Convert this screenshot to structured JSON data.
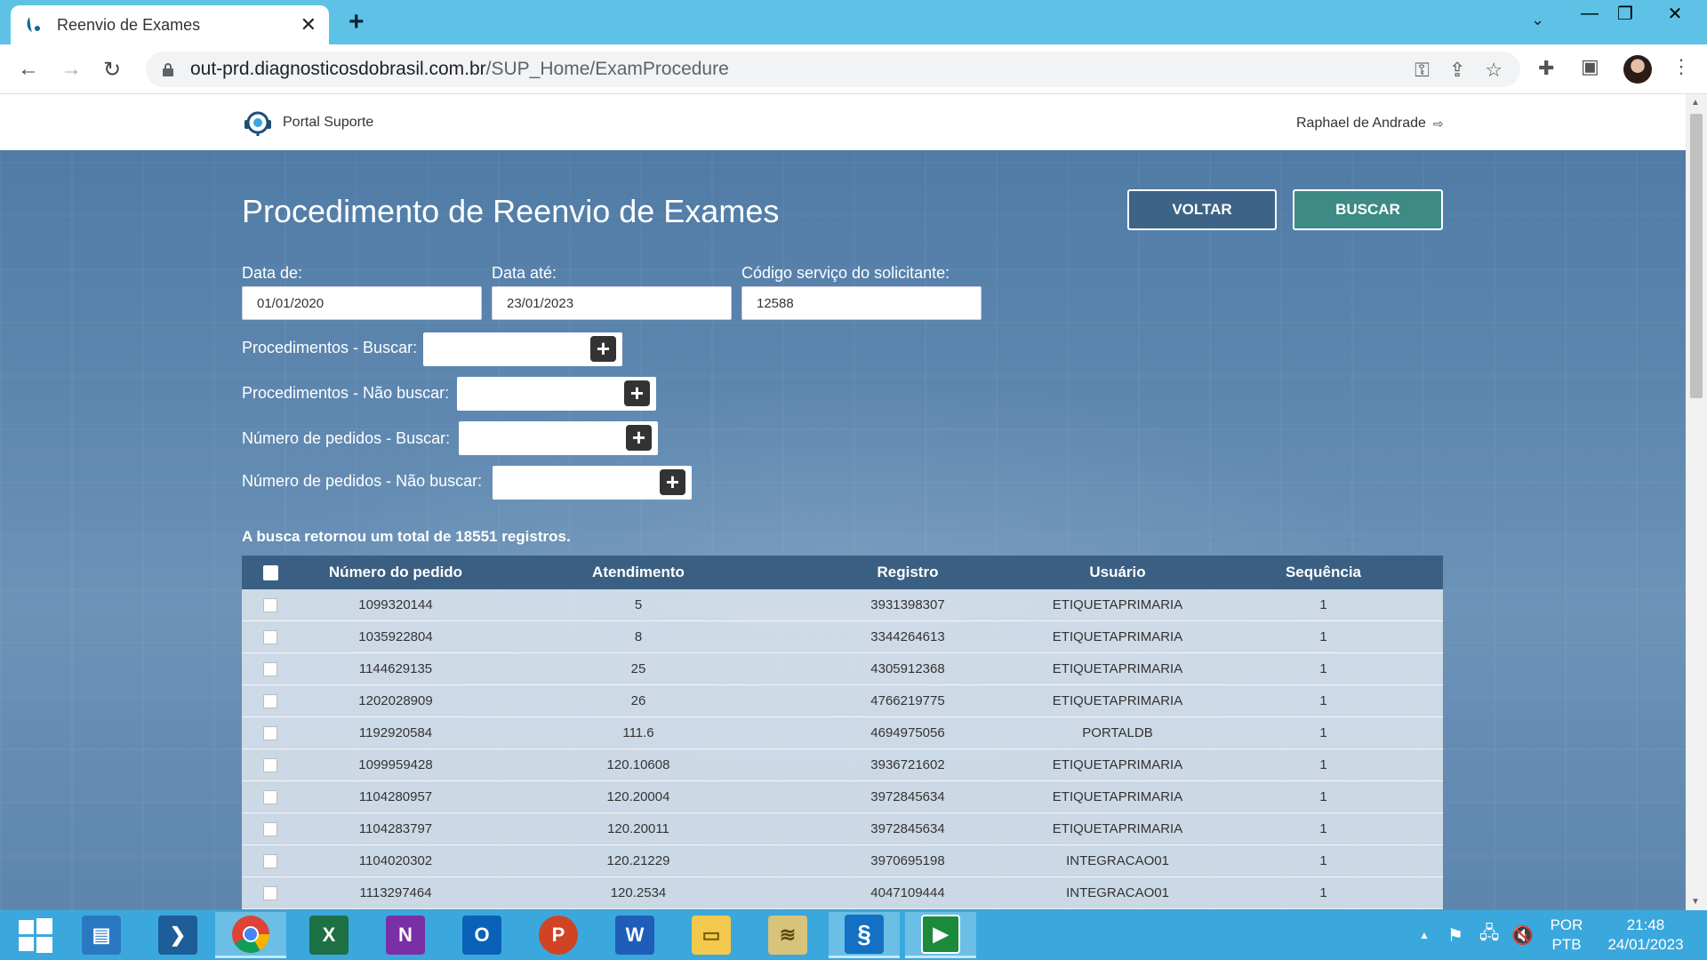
{
  "browser": {
    "tab_title": "Reenvio de Exames",
    "url_host": "out-prd.diagnosticosdobrasil.com.br",
    "url_path": "/SUP_Home/ExamProcedure"
  },
  "header": {
    "brand": "Portal Suporte",
    "user_name": "Raphael de Andrade"
  },
  "page": {
    "title": "Procedimento de Reenvio de Exames",
    "voltar_label": "VOLTAR",
    "buscar_label": "BUSCAR"
  },
  "form": {
    "data_de_label": "Data de:",
    "data_de_value": "01/01/2020",
    "data_ate_label": "Data até:",
    "data_ate_value": "23/01/2023",
    "codigo_label": "Código serviço do solicitante:",
    "codigo_value": "12588",
    "proc_buscar_label": "Procedimentos - Buscar:",
    "proc_nao_buscar_label": "Procedimentos - Não buscar:",
    "ped_buscar_label": "Número de pedidos - Buscar:",
    "ped_nao_buscar_label": "Número de pedidos - Não buscar:",
    "add_symbol": "+"
  },
  "results": {
    "total_text": "A busca retornou um total de 18551 registros.",
    "columns": [
      "Número do pedido",
      "Atendimento",
      "Registro",
      "Usuário",
      "Sequência"
    ],
    "rows": [
      [
        "1099320144",
        "5",
        "3931398307",
        "ETIQUETAPRIMARIA",
        "1"
      ],
      [
        "1035922804",
        "8",
        "3344264613",
        "ETIQUETAPRIMARIA",
        "1"
      ],
      [
        "1144629135",
        "25",
        "4305912368",
        "ETIQUETAPRIMARIA",
        "1"
      ],
      [
        "1202028909",
        "26",
        "4766219775",
        "ETIQUETAPRIMARIA",
        "1"
      ],
      [
        "1192920584",
        "111.6",
        "4694975056",
        "PORTALDB",
        "1"
      ],
      [
        "1099959428",
        "120.10608",
        "3936721602",
        "ETIQUETAPRIMARIA",
        "1"
      ],
      [
        "1104280957",
        "120.20004",
        "3972845634",
        "ETIQUETAPRIMARIA",
        "1"
      ],
      [
        "1104283797",
        "120.20011",
        "3972845634",
        "ETIQUETAPRIMARIA",
        "1"
      ],
      [
        "1104020302",
        "120.21229",
        "3970695198",
        "INTEGRACAO01",
        "1"
      ],
      [
        "1113297464",
        "120.2534",
        "4047109444",
        "INTEGRACAO01",
        "1"
      ]
    ]
  },
  "taskbar": {
    "apps": [
      "start-icon",
      "file-server-icon",
      "powershell-icon",
      "chrome-icon",
      "excel-icon",
      "onenote-icon",
      "outlook-icon",
      "powerpoint-icon",
      "word-icon",
      "file-explorer-icon",
      "money-icon",
      "sync-icon",
      "media-player-icon"
    ],
    "lang_top": "POR",
    "lang_bottom": "PTB",
    "time": "21:48",
    "date": "24/01/2023"
  },
  "colors": {
    "tabbar": "#5dc2e6",
    "taskbar": "#3aa8dd",
    "buscar_button": "#3e8a85",
    "voltar_button": "#3d6387",
    "table_header": "#3b5f82"
  }
}
